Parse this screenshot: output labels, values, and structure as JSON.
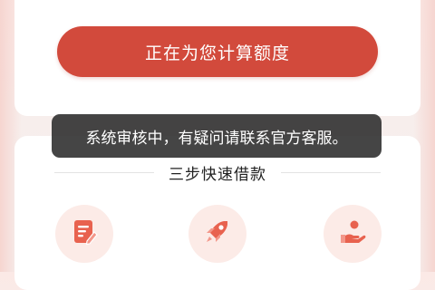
{
  "main": {
    "primary_button_label": "正在为您计算额度"
  },
  "toast": {
    "message": "系统审核中，有疑问请联系官方客服。"
  },
  "steps": {
    "title": "三步快速借款",
    "items": [
      {
        "icon": "edit-form-icon"
      },
      {
        "icon": "rocket-icon"
      },
      {
        "icon": "hand-receive-icon"
      }
    ]
  },
  "colors": {
    "accent": "#d24a3c",
    "icon_bg": "#fcebe7",
    "icon": "#e8624f",
    "toast_bg": "#262626"
  }
}
